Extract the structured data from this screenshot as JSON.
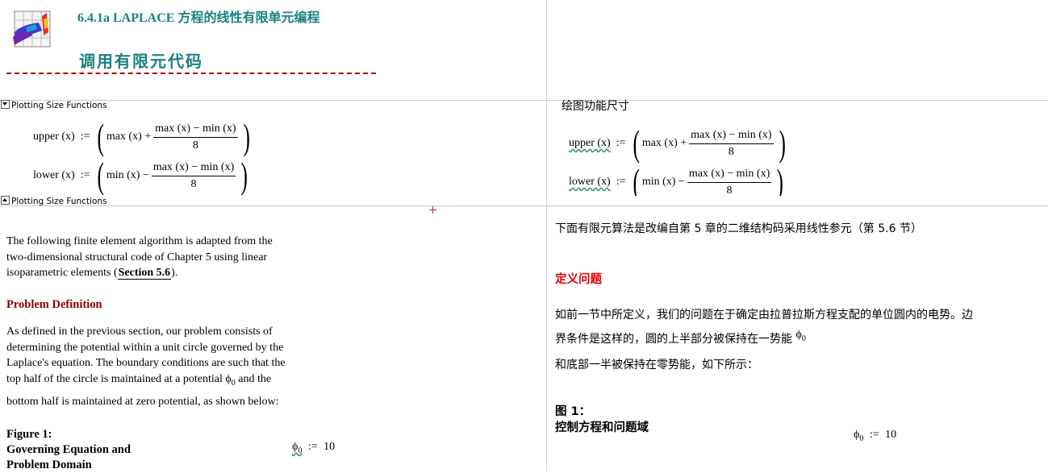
{
  "header": {
    "section_number": "6.4.1a   LAPLACE 方程的线性有限单元编程",
    "section_title": "调用有限元代码"
  },
  "left": {
    "region_top_label": "Plotting Size Functions",
    "region_bottom_label": "Plotting Size Functions",
    "upper_eq": {
      "lhs": "upper (x)",
      "assign": ":=",
      "term": "max (x) +",
      "num": "max (x) − min (x)",
      "den": "8"
    },
    "lower_eq": {
      "lhs": "lower (x)",
      "assign": ":=",
      "term": "min (x) −",
      "num": "max (x) − min (x)",
      "den": "8"
    },
    "intro_line1": "The following finite element algorithm is adapted from the",
    "intro_line2": "two-dimensional structural code of Chapter 5 using linear",
    "intro_line3_pre": "isoparametric elements (",
    "intro_link": "Section 5.6",
    "intro_line3_post": ").",
    "problem_heading": "Problem Definition",
    "problem_line1": "As defined in the previous section, our problem consists of",
    "problem_line2": "determining the potential within a unit circle governed by the",
    "problem_line3": "Laplace's equation. The boundary conditions are such that the",
    "problem_line4_pre": "top half of the circle is maintained at a potential ",
    "problem_line4_phi": "ϕ",
    "problem_line4_sub": "0",
    "problem_line4_post": " and the",
    "problem_line5": "bottom half is maintained at zero potential, as shown below:",
    "figure_label": "Figure 1:",
    "figure_cap1": "Governing Equation and",
    "figure_cap2": "Problem Domain",
    "phi_def": {
      "sym": "ϕ",
      "sub": "0",
      "assign": ":=",
      "value": "10"
    }
  },
  "right": {
    "plot_title": "绘图功能尺寸",
    "upper_eq": {
      "lhs": "upper (x)",
      "assign": ":=",
      "term": "max (x) +",
      "num": "max (x) − min (x)",
      "den": "8"
    },
    "lower_eq": {
      "lhs": "lower (x)",
      "assign": ":=",
      "term": "min (x) −",
      "num": "max (x) − min (x)",
      "den": "8"
    },
    "intro": "下面有限元算法是改编自第 5 章的二维结构码采用线性参元（第 5.6 节）",
    "problem_heading": "定义问题",
    "problem_line1": "如前一节中所定义，我们的问题在于确定由拉普拉斯方程支配的单位圆内的电势。边",
    "problem_line2_pre": "界条件是这样的，圆的上半部分被保持在一势能 ",
    "problem_line2_phi": "ϕ",
    "problem_line2_sub": "0",
    "problem_line3": "和底部一半被保持在零势能，如下所示：",
    "figure_label": "图 1：",
    "figure_cap": "控制方程和问题域",
    "phi_def": {
      "sym": "ϕ",
      "sub": "0",
      "assign": ":=",
      "value": "10"
    }
  }
}
